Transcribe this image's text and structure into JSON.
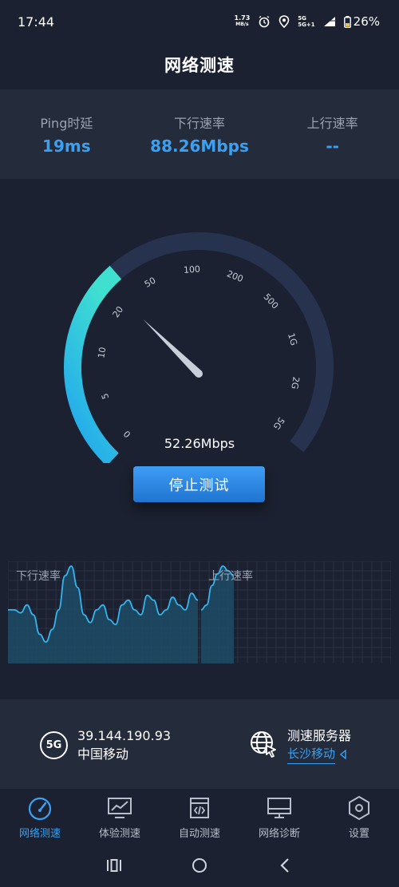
{
  "status_bar": {
    "time": "17:44",
    "net_rate_value": "1.73",
    "net_rate_unit": "MB/s",
    "signal_top": "5G",
    "signal_bottom": "5G+1",
    "battery": "26%"
  },
  "header": {
    "title": "网络测速"
  },
  "stats": {
    "ping": {
      "label": "Ping时延",
      "value": "19ms"
    },
    "download": {
      "label": "下行速率",
      "value": "88.26Mbps"
    },
    "upload": {
      "label": "上行速率",
      "value": "--"
    }
  },
  "gauge": {
    "ticks": [
      "0",
      "5",
      "10",
      "20",
      "50",
      "100",
      "200",
      "500",
      "1G",
      "2G",
      "5G"
    ],
    "progress_fraction": 0.36,
    "needle_fraction": 0.33,
    "current_speed": "52.26Mbps",
    "colors": {
      "track": "#27324e",
      "fill_start": "#40e0d0",
      "fill_end": "#1fa2f0",
      "needle": "#c8cfdb"
    }
  },
  "stop_button": {
    "label": "停止测试"
  },
  "graph": {
    "download_label": "下行速率",
    "upload_label": "上行速率",
    "download_samples": [
      0.55,
      0.55,
      0.52,
      0.6,
      0.5,
      0.3,
      0.22,
      0.35,
      0.55,
      0.9,
      1.0,
      0.78,
      0.5,
      0.42,
      0.55,
      0.6,
      0.45,
      0.4,
      0.6,
      0.65,
      0.55,
      0.5,
      0.7,
      0.65,
      0.5,
      0.55,
      0.68,
      0.6,
      0.55,
      0.72,
      0.65
    ],
    "upload_samples": [
      0.55,
      0.6,
      0.8,
      0.92,
      1.0,
      0.95,
      0.9
    ]
  },
  "info": {
    "network_badge": "5G",
    "ip": "39.144.190.93",
    "carrier": "中国移动",
    "server_title": "测速服务器",
    "server_name": "长沙移动"
  },
  "bottom_nav": {
    "items": [
      {
        "label": "网络测速",
        "icon": "speedometer-icon",
        "active": true
      },
      {
        "label": "体验测速",
        "icon": "trend-monitor-icon",
        "active": false
      },
      {
        "label": "自动测速",
        "icon": "code-document-icon",
        "active": false
      },
      {
        "label": "网络诊断",
        "icon": "monitor-icon",
        "active": false
      },
      {
        "label": "设置",
        "icon": "hexagon-settings-icon",
        "active": false
      }
    ]
  },
  "colors": {
    "background": "#1b2130",
    "panel": "#242b3b",
    "accent": "#3aa1f2",
    "muted_text": "#9aa2b3"
  }
}
